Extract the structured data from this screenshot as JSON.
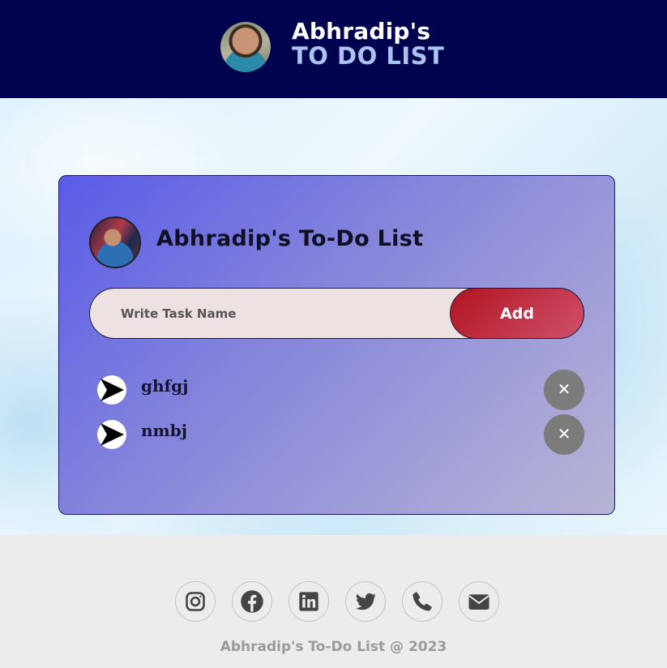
{
  "header": {
    "name_line": "Abhradip's",
    "subtitle_line": "TO DO LIST",
    "avatar_icon": "profile-photo"
  },
  "card": {
    "title": "Abhradip's To-Do List",
    "avatar_icon": "profile-photo",
    "input_placeholder": "Write Task Name",
    "input_value": "",
    "add_label": "Add",
    "tasks": [
      {
        "text": "ghfgj",
        "check_icon": "play-arrow-icon",
        "delete_label": "✕"
      },
      {
        "text": "nmbj",
        "check_icon": "play-arrow-icon",
        "delete_label": "✕"
      }
    ]
  },
  "footer": {
    "social_icons": [
      "instagram-icon",
      "facebook-icon",
      "linkedin-icon",
      "twitter-icon",
      "phone-icon",
      "email-icon"
    ],
    "copyright": "Abhradip's To-Do List @ 2023"
  },
  "colors": {
    "header_bg": "#02034e",
    "header_accent": "#a9c4ee",
    "add_button": "#b01420",
    "delete_button": "#7c7c7c"
  }
}
